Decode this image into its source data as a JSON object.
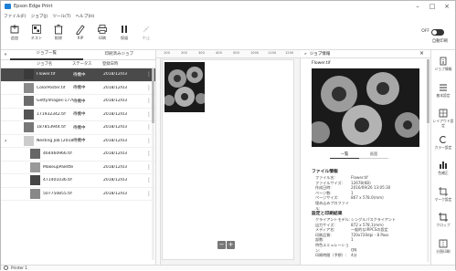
{
  "window": {
    "title": "Epson Edge Print",
    "controls": {
      "minimize": "–",
      "maximize": "□",
      "close": "×"
    }
  },
  "menu": [
    "ファイル(F)",
    "ジョブ(J)",
    "ツール(T)",
    "ヘルプ(H)"
  ],
  "toolbar": {
    "buttons": [
      {
        "label": "追加",
        "icon": "add-file-icon",
        "enabled": true
      },
      {
        "label": "ネスト",
        "icon": "nest-icon",
        "enabled": true
      },
      {
        "label": "削除",
        "icon": "delete-icon",
        "enabled": true
      },
      {
        "label": "RIP",
        "icon": "rip-icon",
        "enabled": true
      },
      {
        "label": "印刷",
        "icon": "print-icon",
        "enabled": true
      },
      {
        "label": "保留",
        "icon": "pause-icon",
        "enabled": true
      },
      {
        "label": "中止",
        "icon": "stop-icon",
        "enabled": false
      }
    ],
    "toggle_label": "OFF",
    "auto_print_label": "自動印刷",
    "accent": "#1b7fd6"
  },
  "left_pane": {
    "tabs": [
      "ジョブ一覧",
      "印刷済みジョブ"
    ],
    "columns": [
      "ジョブ名",
      "ステータス",
      "登録日時"
    ],
    "jobs": [
      {
        "name": "Flower.tif",
        "status": "待機中",
        "date": "2018/12/03",
        "selected": true
      },
      {
        "name": "ColorPoster.tif",
        "status": "待機中",
        "date": "2018/12/03",
        "selected": false
      },
      {
        "name": "GettyImages-177611",
        "status": "待機中",
        "date": "2018/12/03",
        "selected": false
      },
      {
        "name": "171932342.tif",
        "status": "待機中",
        "date": "2018/12/03",
        "selected": false
      },
      {
        "name": "187853944.tif",
        "status": "待機中",
        "date": "2018/12/03",
        "selected": false
      },
      {
        "name": "Nesting Job [2018/1",
        "status": "待機中",
        "date": "2018/12/03",
        "selected": false
      },
      {
        "name": "464460966.tif",
        "status": "",
        "date": "2018/12/03",
        "selected": false
      },
      {
        "name": "MakeupPalette.tif",
        "status": "",
        "date": "2018/12/03",
        "selected": false
      },
      {
        "name": "471401036.tif",
        "status": "",
        "date": "2018/12/03",
        "selected": false
      },
      {
        "name": "507750855.tif",
        "status": "",
        "date": "2018/12/03",
        "selected": false
      }
    ]
  },
  "preview": {
    "ruler": [
      "100",
      "200",
      "300",
      "400",
      "500",
      "1000",
      "1100",
      "1200"
    ],
    "zoom_out": "−",
    "zoom_in": "+"
  },
  "job_info": {
    "header": "ジョブ情報",
    "file_name": "Flower.tif",
    "tabs": [
      "一覧",
      "画面"
    ],
    "file_section": "ファイル情報",
    "file_info": [
      {
        "k": "ファイル名:",
        "v": "Flower.tif"
      },
      {
        "k": "ファイルサイズ:",
        "v": "12678(KB)"
      },
      {
        "k": "作成日時:",
        "v": "2016/09/26 13:05:30"
      },
      {
        "k": "ページ数:",
        "v": "1"
      },
      {
        "k": "ページサイズ:",
        "v": "867 x 578.0(mm)"
      },
      {
        "k": "埋め込みプロファイル:",
        "v": ""
      }
    ],
    "print_section": "設定と印刷結果",
    "print_info": [
      {
        "k": "クライアントモデル:",
        "v": "シングルパスクライアント"
      },
      {
        "k": "出力サイズ:",
        "v": "872 x 578.1(mm)"
      },
      {
        "k": "メディア名:",
        "v": "一般的なIRPCSの設定"
      },
      {
        "k": "印刷品質:",
        "v": "720x720dpi - 8 Pass"
      },
      {
        "k": "部数:",
        "v": "1"
      },
      {
        "k": "特色エミュレーション:",
        "v": "ON"
      },
      {
        "k": "印刷時間（予想）:",
        "v": "4分"
      }
    ]
  },
  "sidebar": [
    {
      "label": "ジョブ情報",
      "icon": "info-icon"
    },
    {
      "label": "基本設定",
      "icon": "list-icon"
    },
    {
      "label": "レイアウト設定",
      "icon": "layout-icon"
    },
    {
      "label": "カラー設定",
      "icon": "color-icon"
    },
    {
      "label": "色補正",
      "icon": "adjust-icon"
    },
    {
      "label": "マーク設定",
      "icon": "marks-icon"
    },
    {
      "label": "クロップ",
      "icon": "crop-icon"
    },
    {
      "label": "分割印刷",
      "icon": "split-icon"
    }
  ],
  "status": {
    "printer": "Printer 1"
  }
}
